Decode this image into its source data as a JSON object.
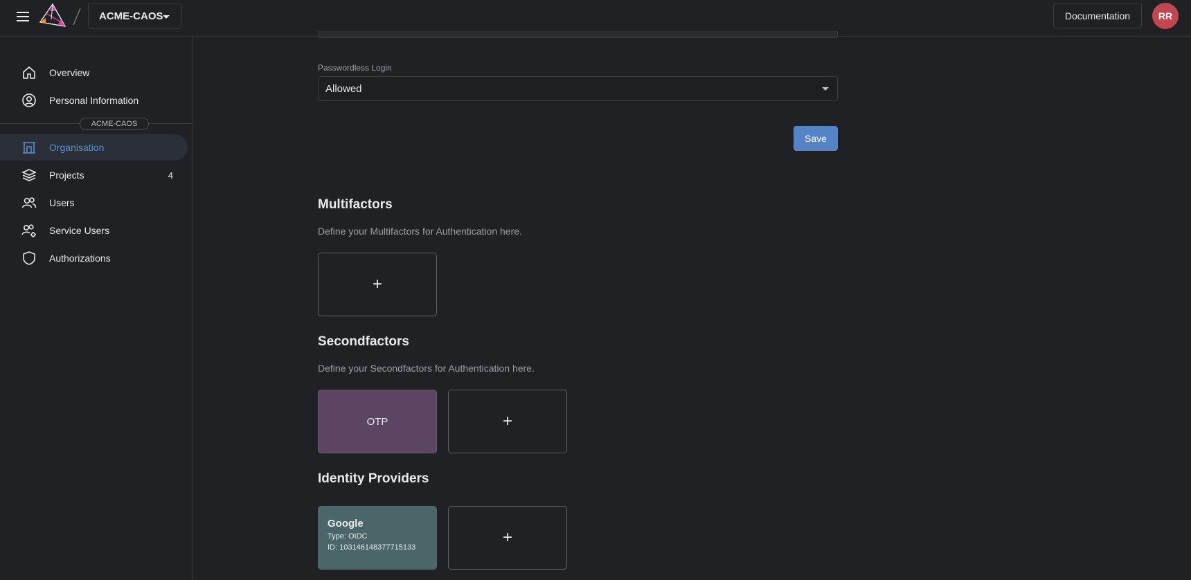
{
  "topbar": {
    "org_name": "ACME-CAOS",
    "documentation_label": "Documentation",
    "avatar_initials": "RR"
  },
  "sidebar": {
    "items": [
      {
        "label": "Overview",
        "icon": "home-icon"
      },
      {
        "label": "Personal Information",
        "icon": "user-circle-icon"
      },
      {
        "label": "Organisation",
        "icon": "building-icon",
        "active": true
      },
      {
        "label": "Projects",
        "icon": "layers-icon",
        "count": "4"
      },
      {
        "label": "Users",
        "icon": "users-icon"
      },
      {
        "label": "Service Users",
        "icon": "service-users-icon"
      },
      {
        "label": "Authorizations",
        "icon": "shield-icon"
      }
    ],
    "org_chip": "ACME-CAOS"
  },
  "main": {
    "passwordless": {
      "label": "Passwordless Login",
      "value": "Allowed"
    },
    "save_label": "Save",
    "multifactors": {
      "title": "Multifactors",
      "description": "Define your Multifactors for Authentication here.",
      "add_symbol": "+"
    },
    "secondfactors": {
      "title": "Secondfactors",
      "description": "Define your Secondfactors for Authentication here.",
      "items": [
        "OTP"
      ],
      "add_symbol": "+"
    },
    "identity_providers": {
      "title": "Identity Providers",
      "items": [
        {
          "name": "Google",
          "type": "Type: OIDC",
          "id": "ID: 103146148377715133"
        }
      ],
      "add_symbol": "+"
    }
  },
  "colors": {
    "background": "#202124",
    "accent": "#5584c6",
    "active_nav": "#5b8fd6",
    "otp_card": "#5b4563",
    "idp_card": "#4a6668",
    "avatar": "#c0474f"
  }
}
